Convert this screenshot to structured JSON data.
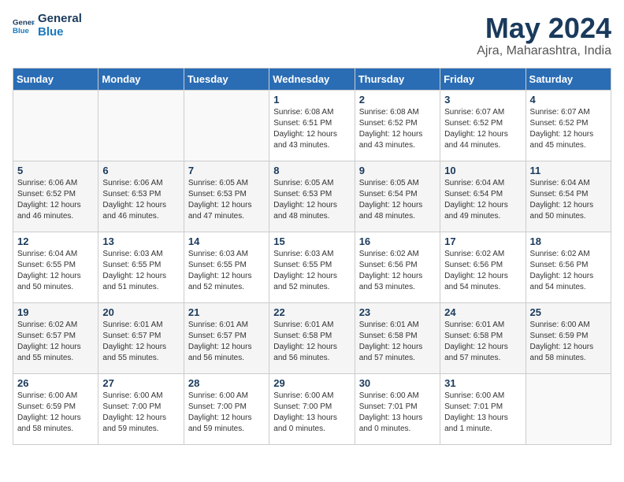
{
  "header": {
    "logo_line1": "General",
    "logo_line2": "Blue",
    "title": "May 2024",
    "subtitle": "Ajra, Maharashtra, India"
  },
  "weekdays": [
    "Sunday",
    "Monday",
    "Tuesday",
    "Wednesday",
    "Thursday",
    "Friday",
    "Saturday"
  ],
  "weeks": [
    [
      {
        "day": "",
        "info": ""
      },
      {
        "day": "",
        "info": ""
      },
      {
        "day": "",
        "info": ""
      },
      {
        "day": "1",
        "info": "Sunrise: 6:08 AM\nSunset: 6:51 PM\nDaylight: 12 hours and 43 minutes."
      },
      {
        "day": "2",
        "info": "Sunrise: 6:08 AM\nSunset: 6:52 PM\nDaylight: 12 hours and 43 minutes."
      },
      {
        "day": "3",
        "info": "Sunrise: 6:07 AM\nSunset: 6:52 PM\nDaylight: 12 hours and 44 minutes."
      },
      {
        "day": "4",
        "info": "Sunrise: 6:07 AM\nSunset: 6:52 PM\nDaylight: 12 hours and 45 minutes."
      }
    ],
    [
      {
        "day": "5",
        "info": "Sunrise: 6:06 AM\nSunset: 6:52 PM\nDaylight: 12 hours and 46 minutes."
      },
      {
        "day": "6",
        "info": "Sunrise: 6:06 AM\nSunset: 6:53 PM\nDaylight: 12 hours and 46 minutes."
      },
      {
        "day": "7",
        "info": "Sunrise: 6:05 AM\nSunset: 6:53 PM\nDaylight: 12 hours and 47 minutes."
      },
      {
        "day": "8",
        "info": "Sunrise: 6:05 AM\nSunset: 6:53 PM\nDaylight: 12 hours and 48 minutes."
      },
      {
        "day": "9",
        "info": "Sunrise: 6:05 AM\nSunset: 6:54 PM\nDaylight: 12 hours and 48 minutes."
      },
      {
        "day": "10",
        "info": "Sunrise: 6:04 AM\nSunset: 6:54 PM\nDaylight: 12 hours and 49 minutes."
      },
      {
        "day": "11",
        "info": "Sunrise: 6:04 AM\nSunset: 6:54 PM\nDaylight: 12 hours and 50 minutes."
      }
    ],
    [
      {
        "day": "12",
        "info": "Sunrise: 6:04 AM\nSunset: 6:55 PM\nDaylight: 12 hours and 50 minutes."
      },
      {
        "day": "13",
        "info": "Sunrise: 6:03 AM\nSunset: 6:55 PM\nDaylight: 12 hours and 51 minutes."
      },
      {
        "day": "14",
        "info": "Sunrise: 6:03 AM\nSunset: 6:55 PM\nDaylight: 12 hours and 52 minutes."
      },
      {
        "day": "15",
        "info": "Sunrise: 6:03 AM\nSunset: 6:55 PM\nDaylight: 12 hours and 52 minutes."
      },
      {
        "day": "16",
        "info": "Sunrise: 6:02 AM\nSunset: 6:56 PM\nDaylight: 12 hours and 53 minutes."
      },
      {
        "day": "17",
        "info": "Sunrise: 6:02 AM\nSunset: 6:56 PM\nDaylight: 12 hours and 54 minutes."
      },
      {
        "day": "18",
        "info": "Sunrise: 6:02 AM\nSunset: 6:56 PM\nDaylight: 12 hours and 54 minutes."
      }
    ],
    [
      {
        "day": "19",
        "info": "Sunrise: 6:02 AM\nSunset: 6:57 PM\nDaylight: 12 hours and 55 minutes."
      },
      {
        "day": "20",
        "info": "Sunrise: 6:01 AM\nSunset: 6:57 PM\nDaylight: 12 hours and 55 minutes."
      },
      {
        "day": "21",
        "info": "Sunrise: 6:01 AM\nSunset: 6:57 PM\nDaylight: 12 hours and 56 minutes."
      },
      {
        "day": "22",
        "info": "Sunrise: 6:01 AM\nSunset: 6:58 PM\nDaylight: 12 hours and 56 minutes."
      },
      {
        "day": "23",
        "info": "Sunrise: 6:01 AM\nSunset: 6:58 PM\nDaylight: 12 hours and 57 minutes."
      },
      {
        "day": "24",
        "info": "Sunrise: 6:01 AM\nSunset: 6:58 PM\nDaylight: 12 hours and 57 minutes."
      },
      {
        "day": "25",
        "info": "Sunrise: 6:00 AM\nSunset: 6:59 PM\nDaylight: 12 hours and 58 minutes."
      }
    ],
    [
      {
        "day": "26",
        "info": "Sunrise: 6:00 AM\nSunset: 6:59 PM\nDaylight: 12 hours and 58 minutes."
      },
      {
        "day": "27",
        "info": "Sunrise: 6:00 AM\nSunset: 7:00 PM\nDaylight: 12 hours and 59 minutes."
      },
      {
        "day": "28",
        "info": "Sunrise: 6:00 AM\nSunset: 7:00 PM\nDaylight: 12 hours and 59 minutes."
      },
      {
        "day": "29",
        "info": "Sunrise: 6:00 AM\nSunset: 7:00 PM\nDaylight: 13 hours and 0 minutes."
      },
      {
        "day": "30",
        "info": "Sunrise: 6:00 AM\nSunset: 7:01 PM\nDaylight: 13 hours and 0 minutes."
      },
      {
        "day": "31",
        "info": "Sunrise: 6:00 AM\nSunset: 7:01 PM\nDaylight: 13 hours and 1 minute."
      },
      {
        "day": "",
        "info": ""
      }
    ]
  ]
}
